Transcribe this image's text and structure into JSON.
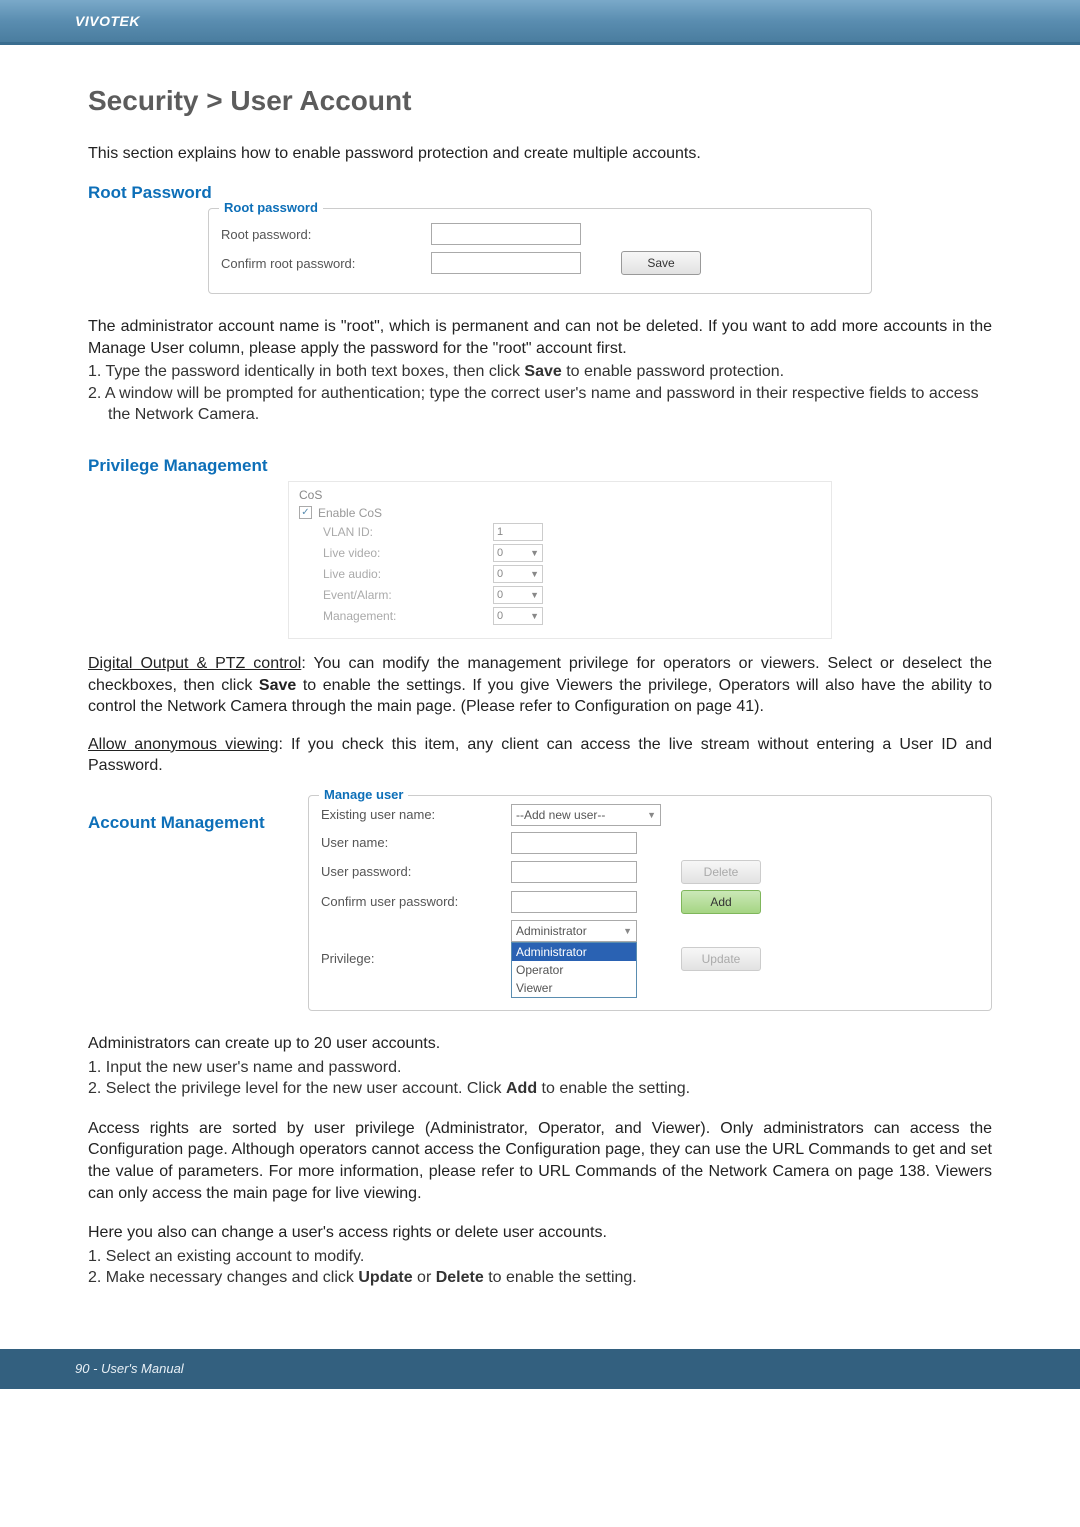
{
  "header": {
    "brand": "VIVOTEK"
  },
  "breadcrumb": "Security > User Account",
  "intro": "This section explains how to enable password protection and create multiple accounts.",
  "root_password": {
    "heading": "Root Password",
    "legend": "Root password",
    "row1_label": "Root password:",
    "row2_label": "Confirm root password:",
    "save_label": "Save"
  },
  "admin_para": "The administrator account name is \"root\", which is permanent and can not be deleted. If you want to add more accounts in the Manage User column, please apply the password for the \"root\" account first.",
  "admin_step1_pre": "1. Type the password identically in both text boxes, then click ",
  "admin_step1_bold": "Save",
  "admin_step1_post": " to enable password protection.",
  "admin_step2": "2. A window will be prompted for authentication; type the correct user's name and password in their respective fields to access the Network Camera.",
  "privilege": {
    "heading": "Privilege Management",
    "cos_title": "CoS",
    "enable_cos": "Enable CoS",
    "vlan_label": "VLAN ID:",
    "vlan_val": "1",
    "live_video_label": "Live video:",
    "live_video_val": "0",
    "live_audio_label": "Live audio:",
    "live_audio_val": "0",
    "event_label": "Event/Alarm:",
    "event_val": "0",
    "mgmt_label": "Management:",
    "mgmt_val": "0"
  },
  "digital_label": "Digital Output & PTZ control",
  "digital_para_pre": ": You can modify the management privilege for operators or viewers. Select or deselect the checkboxes, then click ",
  "digital_bold": "Save",
  "digital_para_post": " to enable the settings. If you give Viewers the privilege, Operators will also have the ability to control the Network Camera through the main page. (Please refer to Configuration on page 41).",
  "anon_label": "Allow anonymous viewing",
  "anon_para": ": If you check this item, any client can access the live stream without entering a User ID and Password.",
  "account": {
    "heading": "Account Management",
    "legend": "Manage user",
    "existing_label": "Existing user name:",
    "existing_val": "--Add new user--",
    "username_label": "User name:",
    "userpass_label": "User password:",
    "confirmpass_label": "Confirm user password:",
    "privilege_label": "Privilege:",
    "priv_selected": "Administrator",
    "priv_opt1": "Administrator",
    "priv_opt2": "Operator",
    "priv_opt3": "Viewer",
    "delete_label": "Delete",
    "add_label": "Add",
    "update_label": "Update"
  },
  "admins_para": "Administrators can create up to 20 user accounts.",
  "admins_step1": "1. Input the new user's name and password.",
  "admins_step2_pre": "2. Select the privilege level for the new user account. Click ",
  "admins_step2_bold": "Add",
  "admins_step2_post": " to enable the setting.",
  "access_para": "Access rights are sorted by user privilege (Administrator, Operator, and Viewer). Only administrators can access the Configuration page. Although operators cannot access the Configuration page, they can use the URL Commands to get and set the value of parameters. For more information, please refer to URL Commands of the Network Camera on page 138. Viewers can only access the main page for live viewing.",
  "change_para": "Here you also can change a user's access rights or delete user accounts.",
  "change_step1": "1. Select an existing account to modify.",
  "change_step2_pre": "2. Make necessary changes and click ",
  "change_step2_b1": "Update",
  "change_step2_mid": " or ",
  "change_step2_b2": "Delete",
  "change_step2_post": " to enable the setting.",
  "footer": "90 - User's Manual"
}
